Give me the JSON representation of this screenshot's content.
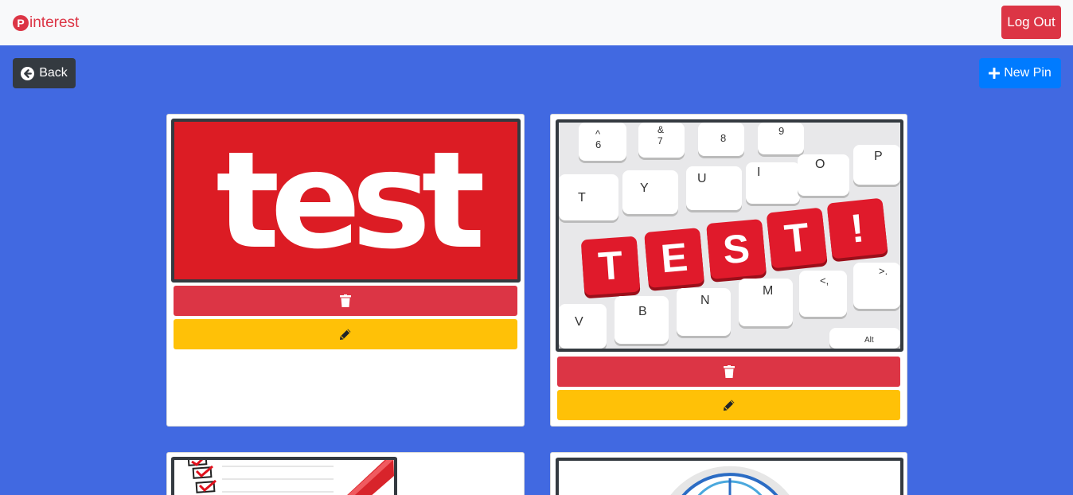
{
  "nav": {
    "brand_letter": "P",
    "brand_text": "interest",
    "logout_label": "Log Out"
  },
  "toolbar": {
    "back_label": "Back",
    "new_pin_label": "New Pin"
  },
  "pins": [
    {
      "image_word": "test"
    },
    {
      "key_letters": [
        "T",
        "E",
        "S",
        "T",
        "!"
      ],
      "keyboard_rows": [
        [
          "^6",
          "&7",
          "8",
          "9"
        ],
        [
          "T",
          "Y",
          "U",
          "I",
          "O",
          "P"
        ],
        [
          "V",
          "B",
          "N",
          "M",
          "<,",
          ">."
        ]
      ],
      "alt_key": "Alt"
    },
    {},
    {}
  ],
  "colors": {
    "danger": "#dc3545",
    "warning": "#ffc107",
    "dark": "#343a40",
    "primary": "#007bff",
    "background": "#4169e1"
  }
}
